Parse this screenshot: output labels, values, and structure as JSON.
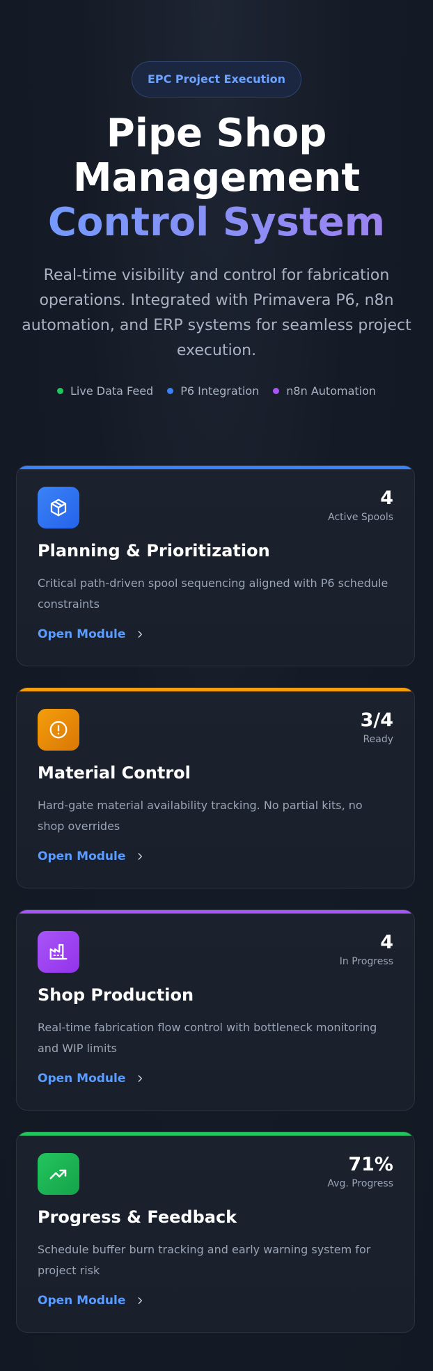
{
  "hero": {
    "badge": "EPC Project Execution",
    "title_line1": "Pipe Shop",
    "title_line2": "Management",
    "title_line3": "Control System",
    "subtitle": "Real-time visibility and control for fabrication operations. Integrated with Primavera P6, n8n automation, and ERP systems for seamless project execution.",
    "legend": [
      {
        "label": "Live Data Feed",
        "color": "#22c55e"
      },
      {
        "label": "P6 Integration",
        "color": "#3b82f6"
      },
      {
        "label": "n8n Automation",
        "color": "#a855f7"
      }
    ]
  },
  "cards": [
    {
      "title": "Planning & Prioritization",
      "description": "Critical path-driven spool sequencing aligned with P6 schedule constraints",
      "stat_value": "4",
      "stat_label": "Active Spools",
      "link": "Open Module",
      "accent": "#3b82f6",
      "icon": "box-icon"
    },
    {
      "title": "Material Control",
      "description": "Hard-gate material availability tracking. No partial kits, no shop overrides",
      "stat_value": "3/4",
      "stat_label": "Ready",
      "link": "Open Module",
      "accent": "#f59e0b",
      "icon": "alert-circle-icon"
    },
    {
      "title": "Shop Production",
      "description": "Real-time fabrication flow control with bottleneck monitoring and WIP limits",
      "stat_value": "4",
      "stat_label": "In Progress",
      "link": "Open Module",
      "accent": "#a855f7",
      "icon": "factory-icon"
    },
    {
      "title": "Progress & Feedback",
      "description": "Schedule buffer burn tracking and early warning system for project risk",
      "stat_value": "71%",
      "stat_label": "Avg. Progress",
      "link": "Open Module",
      "accent": "#22c55e",
      "icon": "trending-up-icon"
    }
  ]
}
